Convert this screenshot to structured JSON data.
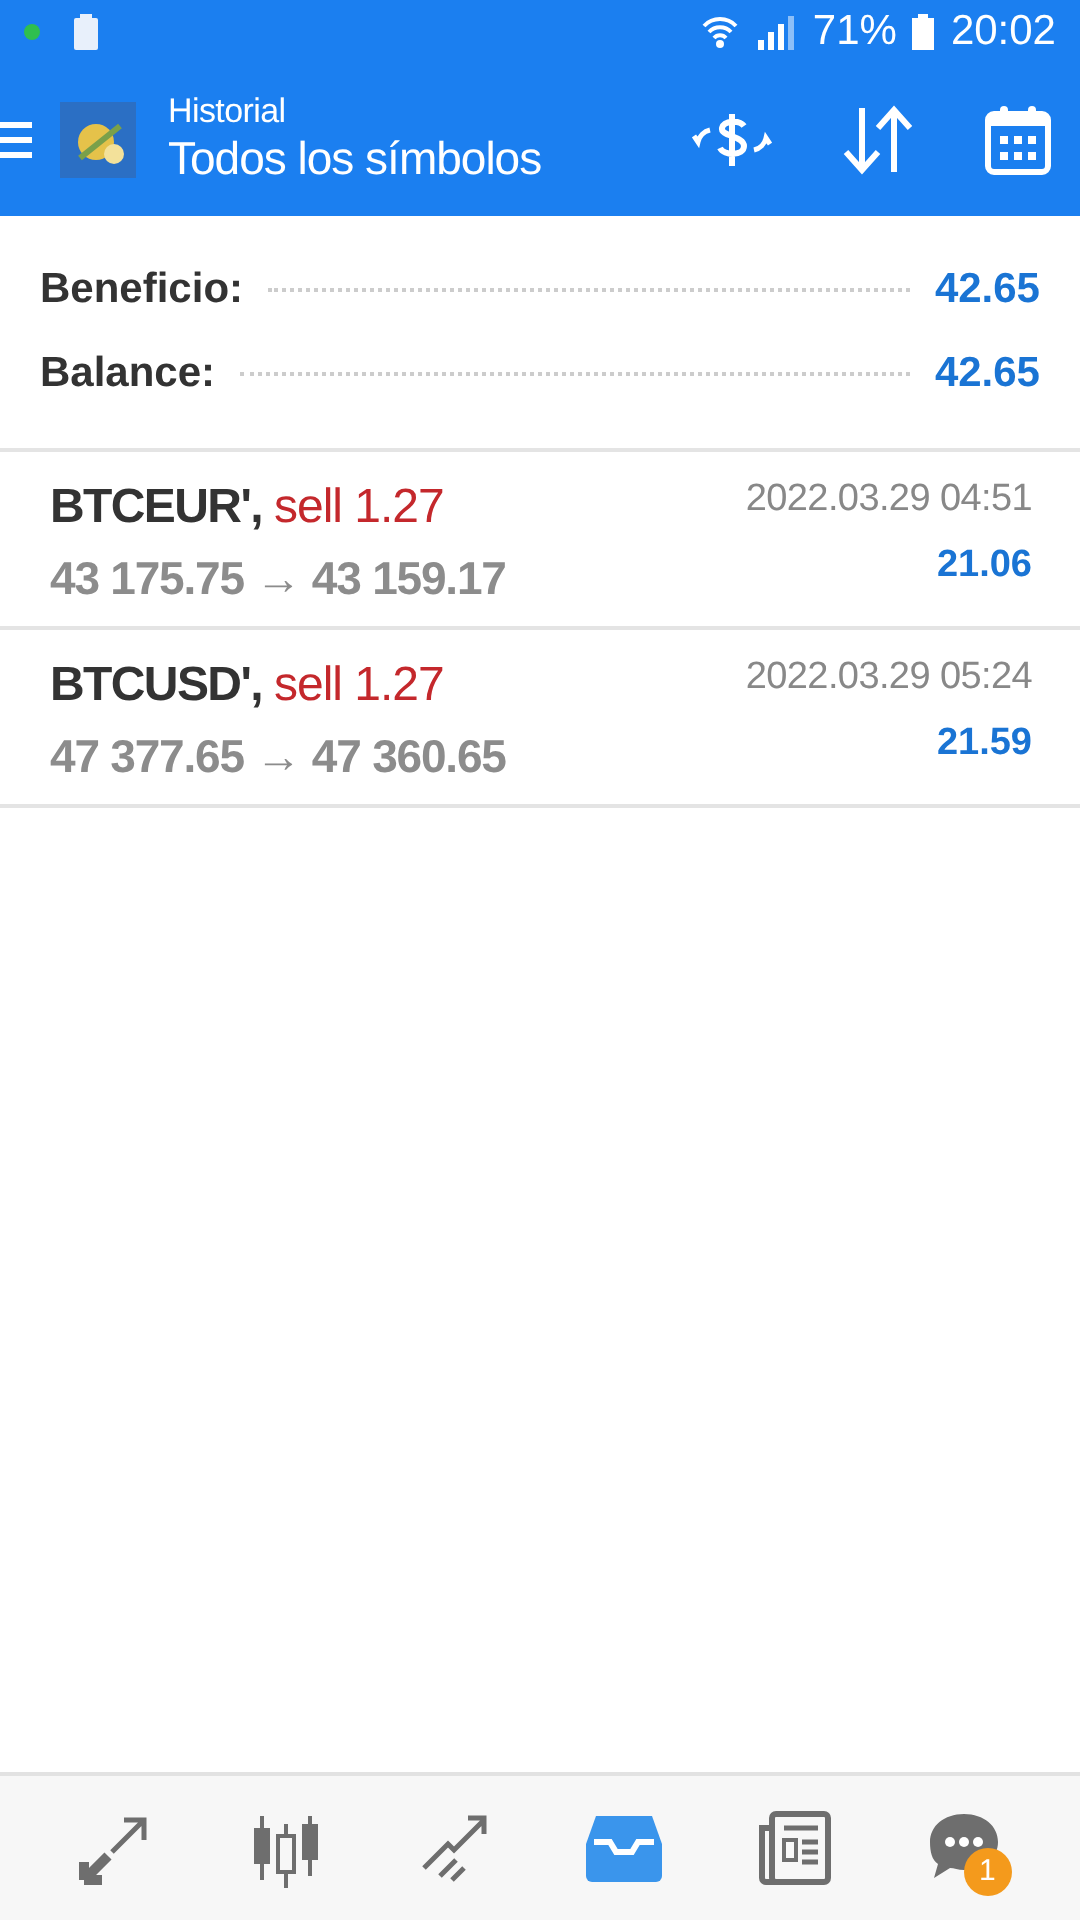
{
  "status_bar": {
    "battery": "71%",
    "time": "20:02"
  },
  "app_bar": {
    "subtitle": "Historial",
    "title": "Todos los símbolos"
  },
  "summary": [
    {
      "label": "Beneficio:",
      "value": "42.65"
    },
    {
      "label": "Balance:",
      "value": "42.65"
    }
  ],
  "trades": [
    {
      "symbol": "BTCEUR',",
      "side": "sell 1.27",
      "prices": "43 175.75 → 43 159.17",
      "time": "2022.03.29 04:51",
      "profit": "21.06"
    },
    {
      "symbol": "BTCUSD',",
      "side": "sell 1.27",
      "prices": "47 377.65 → 47 360.65",
      "time": "2022.03.29 05:24",
      "profit": "21.59"
    }
  ],
  "bottom_nav": [
    {
      "kind": "trade",
      "selected": false
    },
    {
      "kind": "chart",
      "selected": false
    },
    {
      "kind": "trend",
      "selected": false
    },
    {
      "kind": "history",
      "selected": true
    },
    {
      "kind": "news",
      "selected": false
    },
    {
      "kind": "chat",
      "selected": false,
      "badge": "1"
    }
  ]
}
